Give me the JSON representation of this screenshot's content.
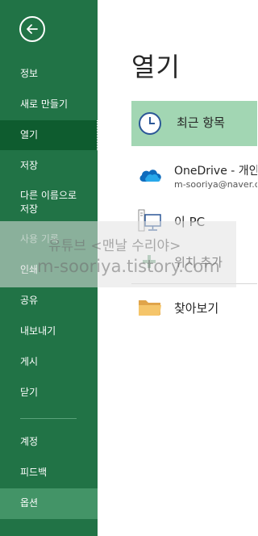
{
  "sidebar": {
    "back_icon": "back-arrow-icon",
    "items": [
      {
        "label": "정보"
      },
      {
        "label": "새로 만들기"
      },
      {
        "label": "열기"
      },
      {
        "label": "저장"
      },
      {
        "label": "다른 이름으로",
        "label2": "저장"
      },
      {
        "label": "사용 기록"
      },
      {
        "label": "인쇄"
      },
      {
        "label": "공유"
      },
      {
        "label": "내보내기"
      },
      {
        "label": "게시"
      },
      {
        "label": "닫기"
      },
      {
        "label": "계정"
      },
      {
        "label": "피드백"
      },
      {
        "label": "옵션"
      }
    ],
    "selected": "열기",
    "colors": {
      "bg": "#217346",
      "selected": "#0e5c2f",
      "hover": "#439467"
    }
  },
  "main": {
    "title": "열기",
    "locations": [
      {
        "label": "최근 항목",
        "icon": "clock-icon",
        "selected": true
      },
      {
        "label": "OneDrive - 개인",
        "sublabel": "m-sooriya@naver.com",
        "icon": "cloud-icon"
      },
      {
        "label": "이 PC",
        "icon": "computer-icon"
      },
      {
        "label": "위치 추가",
        "icon": "plus-icon"
      },
      {
        "label": "찾아보기",
        "icon": "folder-icon"
      }
    ]
  },
  "watermark": {
    "line1": "유튜브 <맨날 수리야>",
    "line2": "m-sooriya.tistory.com"
  }
}
